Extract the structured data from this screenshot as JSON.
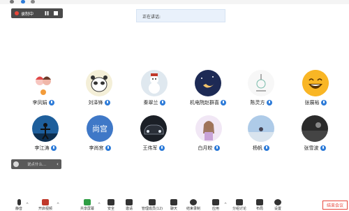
{
  "recording": {
    "status_label": "录制中"
  },
  "speaking": {
    "label": "正在讲话:"
  },
  "participants": [
    {
      "name": "李凤娟",
      "avatar_style": "couple-cartoon",
      "avatar_text": ""
    },
    {
      "name": "刘泽锋",
      "avatar_style": "panda-cartoon",
      "avatar_text": ""
    },
    {
      "name": "秦翠兰",
      "avatar_style": "snowman",
      "avatar_text": ""
    },
    {
      "name": "机电院赵群喜",
      "avatar_style": "moon-night",
      "avatar_text": ""
    },
    {
      "name": "陈灵方",
      "avatar_style": "sketch",
      "avatar_text": ""
    },
    {
      "name": "张展裕",
      "avatar_style": "emoji-laugh",
      "avatar_text": ""
    },
    {
      "name": "李江涛",
      "avatar_style": "silhouette",
      "avatar_text": ""
    },
    {
      "name": "李尚宫",
      "avatar_style": "initials",
      "avatar_text": "尚宫"
    },
    {
      "name": "王伟军",
      "avatar_style": "car",
      "avatar_text": ""
    },
    {
      "name": "白月皎",
      "avatar_style": "anime",
      "avatar_text": ""
    },
    {
      "name": "杨帆",
      "avatar_style": "sky",
      "avatar_text": ""
    },
    {
      "name": "张雪波",
      "avatar_style": "dark-landscape",
      "avatar_text": ""
    }
  ],
  "chat": {
    "placeholder": "说点什么..."
  },
  "toolbar": {
    "items": [
      {
        "label": "静音",
        "icon": "microphone-icon"
      },
      {
        "label": "开启视频",
        "icon": "video-icon"
      },
      {
        "label": "共享屏幕",
        "icon": "share-screen-icon"
      },
      {
        "label": "安全",
        "icon": "shield-icon"
      },
      {
        "label": "邀请",
        "icon": "invite-icon"
      },
      {
        "label": "管理成员(12)",
        "icon": "members-icon"
      },
      {
        "label": "聊天",
        "icon": "chat-icon"
      },
      {
        "label": "结束录制",
        "icon": "record-icon"
      },
      {
        "label": "应用",
        "icon": "apps-icon"
      },
      {
        "label": "分组讨论",
        "icon": "breakout-icon"
      },
      {
        "label": "布局",
        "icon": "layout-icon"
      },
      {
        "label": "设置",
        "icon": "gear-icon"
      }
    ],
    "end_label": "结束会议"
  },
  "colors": {
    "accent": "#2d7bd8",
    "danger": "#e8473b",
    "recbar": "#4a4a4a"
  }
}
